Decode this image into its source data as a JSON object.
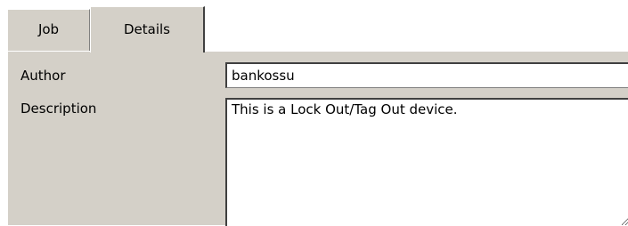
{
  "tabs": {
    "job": {
      "label": "Job",
      "selected": false
    },
    "details": {
      "label": "Details",
      "selected": true
    }
  },
  "details": {
    "author": {
      "label": "Author",
      "value": "bankossu"
    },
    "description": {
      "label": "Description",
      "value": "This is a Lock Out/Tag Out device."
    }
  },
  "colors": {
    "panel_background": "#d4d0c8",
    "field_background": "#ffffff",
    "border_dark": "#404040",
    "border_light": "#ffffff"
  }
}
